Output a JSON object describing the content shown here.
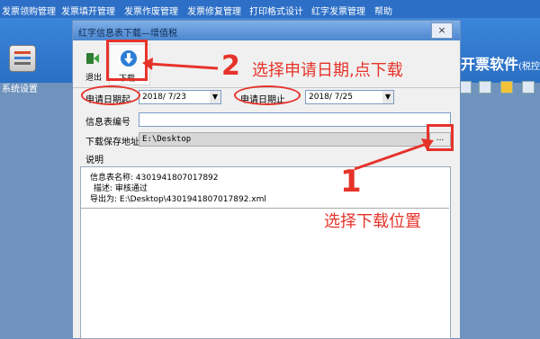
{
  "menu": [
    "发票领购管理",
    "发票填开管理",
    "发票作废管理",
    "发票修复管理",
    "打印格式设计",
    "红字发票管理",
    "帮助"
  ],
  "app": {
    "system_settings": "系统设置",
    "brand": "开票软件",
    "brand_suffix": "(税控盘版)"
  },
  "dialog": {
    "title": "红字信息表下载—增值税",
    "close": "×",
    "toolbar": {
      "exit": "退出",
      "download": "下载"
    },
    "apply_date_from_label": "申请日期起",
    "apply_date_from": "2018/ 7/23",
    "apply_date_to_label": "申请日期止",
    "apply_date_to": "2018/ 7/25",
    "info_number_label": "信息表编号",
    "info_number": "",
    "save_path_label": "下载保存地址",
    "save_path": "E:\\Desktop",
    "browse": "...",
    "description_label": "说明",
    "desc": {
      "line1": "信息表名称: 4301941807017892",
      "line2": "描述: 审核通过",
      "line3": "导出为: E:\\Desktop\\4301941807017892.xml"
    }
  },
  "annotations": {
    "step2_number": "2",
    "step2_text": "选择申请日期,点下载",
    "step1_number": "1",
    "step1_text": "选择下载位置",
    "color": "#e6332a"
  }
}
